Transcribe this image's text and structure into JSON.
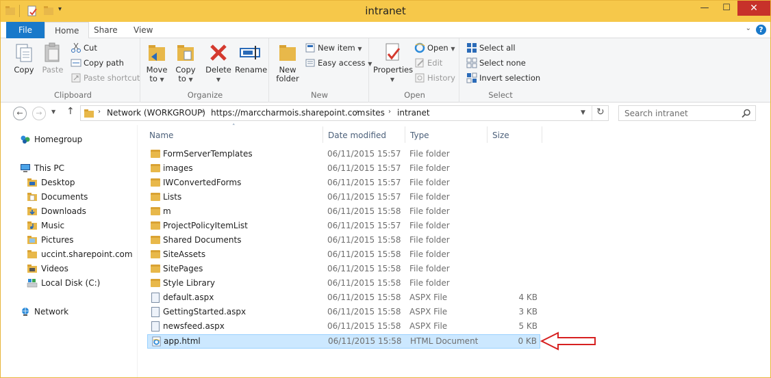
{
  "window": {
    "title": "intranet"
  },
  "ribbon": {
    "tabs": [
      {
        "label": "File"
      },
      {
        "label": "Home"
      },
      {
        "label": "Share"
      },
      {
        "label": "View"
      }
    ],
    "clipboard": {
      "label": "Clipboard",
      "copy": "Copy",
      "paste": "Paste",
      "cut": "Cut",
      "copy_path": "Copy path",
      "paste_shortcut": "Paste shortcut"
    },
    "organize": {
      "label": "Organize",
      "move_to": "Move",
      "move_to_2": "to",
      "copy_to": "Copy",
      "copy_to_2": "to",
      "delete": "Delete",
      "rename": "Rename"
    },
    "new": {
      "label": "New",
      "new_folder": "New",
      "new_folder_2": "folder",
      "new_item": "New item",
      "easy_access": "Easy access"
    },
    "open": {
      "label": "Open",
      "properties": "Properties",
      "open": "Open",
      "edit": "Edit",
      "history": "History"
    },
    "select": {
      "label": "Select",
      "select_all": "Select all",
      "select_none": "Select none",
      "invert_selection": "Invert selection"
    }
  },
  "address": {
    "crumbs": [
      {
        "label": "Network (WORKGROUP)"
      },
      {
        "label": "https://marccharmois.sharepoint.com"
      },
      {
        "label": "sites"
      },
      {
        "label": "intranet"
      }
    ],
    "search_placeholder": "Search intranet"
  },
  "nav": {
    "homegroup": "Homegroup",
    "this_pc": "This PC",
    "items": [
      {
        "label": "Desktop"
      },
      {
        "label": "Documents"
      },
      {
        "label": "Downloads"
      },
      {
        "label": "Music"
      },
      {
        "label": "Pictures"
      },
      {
        "label": "uccint.sharepoint.com"
      },
      {
        "label": "Videos"
      },
      {
        "label": "Local Disk (C:)"
      }
    ],
    "network": "Network"
  },
  "columns": {
    "name": "Name",
    "date": "Date modified",
    "type": "Type",
    "size": "Size"
  },
  "files": [
    {
      "name": "FormServerTemplates",
      "date": "06/11/2015 15:57",
      "type": "File folder",
      "size": "",
      "kind": "folder"
    },
    {
      "name": "images",
      "date": "06/11/2015 15:57",
      "type": "File folder",
      "size": "",
      "kind": "folder"
    },
    {
      "name": "IWConvertedForms",
      "date": "06/11/2015 15:57",
      "type": "File folder",
      "size": "",
      "kind": "folder"
    },
    {
      "name": "Lists",
      "date": "06/11/2015 15:57",
      "type": "File folder",
      "size": "",
      "kind": "folder"
    },
    {
      "name": "m",
      "date": "06/11/2015 15:58",
      "type": "File folder",
      "size": "",
      "kind": "folder"
    },
    {
      "name": "ProjectPolicyItemList",
      "date": "06/11/2015 15:57",
      "type": "File folder",
      "size": "",
      "kind": "folder"
    },
    {
      "name": "Shared Documents",
      "date": "06/11/2015 15:58",
      "type": "File folder",
      "size": "",
      "kind": "folder"
    },
    {
      "name": "SiteAssets",
      "date": "06/11/2015 15:58",
      "type": "File folder",
      "size": "",
      "kind": "folder"
    },
    {
      "name": "SitePages",
      "date": "06/11/2015 15:58",
      "type": "File folder",
      "size": "",
      "kind": "folder"
    },
    {
      "name": "Style Library",
      "date": "06/11/2015 15:58",
      "type": "File folder",
      "size": "",
      "kind": "folder"
    },
    {
      "name": "default.aspx",
      "date": "06/11/2015 15:58",
      "type": "ASPX File",
      "size": "4 KB",
      "kind": "doc"
    },
    {
      "name": "GettingStarted.aspx",
      "date": "06/11/2015 15:58",
      "type": "ASPX File",
      "size": "3 KB",
      "kind": "doc"
    },
    {
      "name": "newsfeed.aspx",
      "date": "06/11/2015 15:58",
      "type": "ASPX File",
      "size": "5 KB",
      "kind": "doc"
    },
    {
      "name": "app.html",
      "date": "06/11/2015 15:58",
      "type": "HTML Document",
      "size": "0 KB",
      "kind": "html",
      "selected": true
    }
  ],
  "colors": {
    "titlebar": "#f6c84a",
    "file_tab": "#1979ca",
    "selection": "#cce8ff",
    "arrow": "#d62020"
  }
}
